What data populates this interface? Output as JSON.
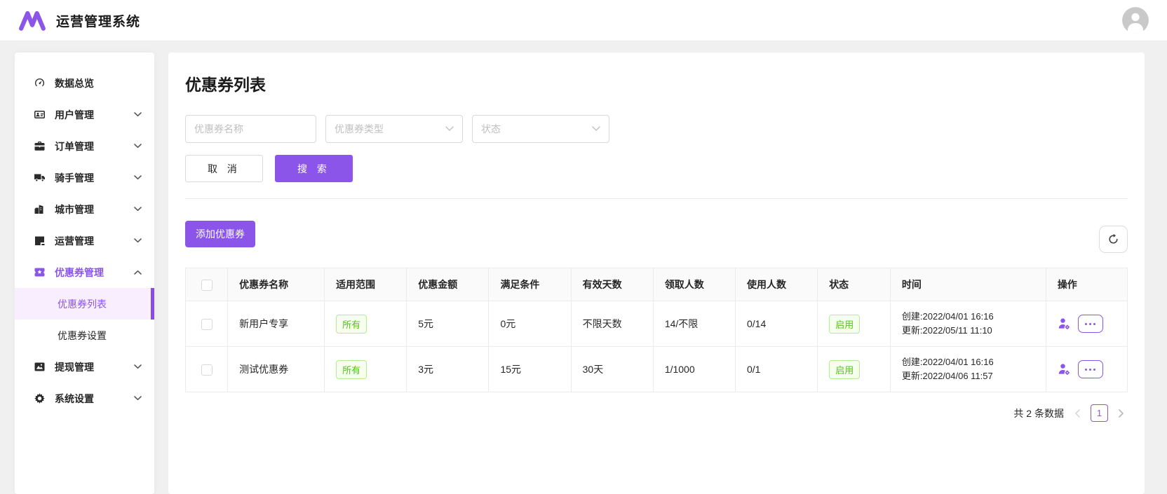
{
  "header": {
    "app_title": "运营管理系统"
  },
  "sidebar": {
    "items": [
      {
        "label": "数据总览"
      },
      {
        "label": "用户管理"
      },
      {
        "label": "订单管理"
      },
      {
        "label": "骑手管理"
      },
      {
        "label": "城市管理"
      },
      {
        "label": "运营管理"
      },
      {
        "label": "优惠券管理",
        "children": [
          {
            "label": "优惠券列表"
          },
          {
            "label": "优惠券设置"
          }
        ]
      },
      {
        "label": "提现管理"
      },
      {
        "label": "系统设置"
      }
    ]
  },
  "main": {
    "page_title": "优惠券列表",
    "filters": {
      "name_placeholder": "优惠券名称",
      "type_value": "优惠券类型",
      "status_value": "状态"
    },
    "buttons": {
      "cancel": "取 消",
      "search": "搜 索",
      "add": "添加优惠券"
    },
    "table": {
      "columns": [
        "优惠券名称",
        "适用范围",
        "优惠金额",
        "满足条件",
        "有效天数",
        "领取人数",
        "使用人数",
        "状态",
        "时间",
        "操作"
      ],
      "rows": [
        {
          "name": "新用户专享",
          "scope": "所有",
          "amount": "5元",
          "condition": "0元",
          "valid_days": "不限天数",
          "claimed": "14/不限",
          "used": "0/14",
          "status": "启用",
          "created": "创建:2022/04/01 16:16",
          "updated": "更新:2022/05/11 11:10"
        },
        {
          "name": "测试优惠券",
          "scope": "所有",
          "amount": "3元",
          "condition": "15元",
          "valid_days": "30天",
          "claimed": "1/1000",
          "used": "0/1",
          "status": "启用",
          "created": "创建:2022/04/01 16:16",
          "updated": "更新:2022/04/06 11:57"
        }
      ]
    },
    "pagination": {
      "total": "共 2 条数据",
      "page": "1"
    }
  },
  "colors": {
    "accent": "#8a55e8",
    "accent_light_bg": "#f9eefe",
    "green_text": "#52c41a",
    "green_border": "#b7eb8f",
    "green_bg": "#f6ffed",
    "page_bg": "#f0f0f0"
  }
}
